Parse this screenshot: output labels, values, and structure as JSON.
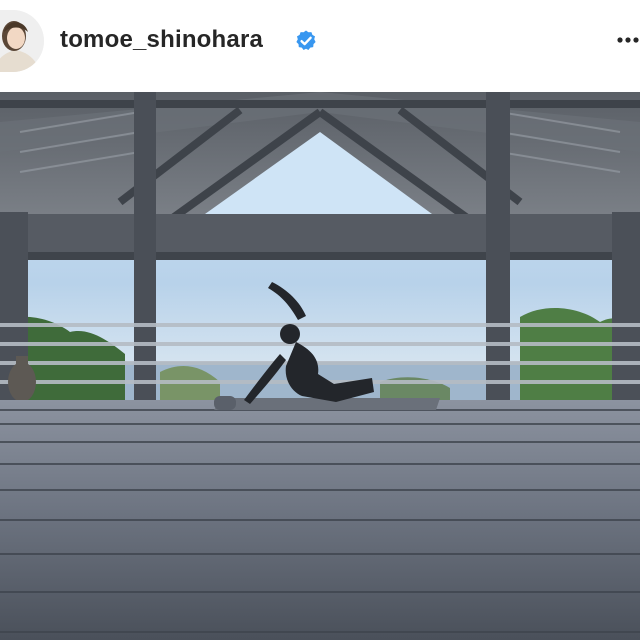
{
  "post": {
    "username": "tomoe_shinohara",
    "verified": true,
    "icons": {
      "verified": "verified-badge-icon",
      "more": "more-options-icon"
    },
    "colors": {
      "text": "#262626",
      "verified_badge": "#3897f0",
      "background": "#ffffff"
    }
  }
}
